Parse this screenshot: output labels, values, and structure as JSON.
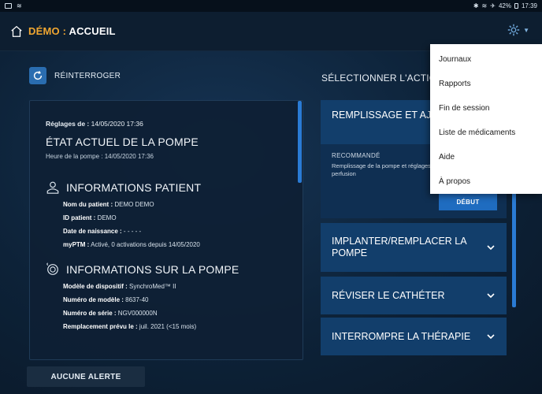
{
  "status_bar": {
    "battery": "42%",
    "time": "17:39"
  },
  "header": {
    "demo": "DÉMO",
    "separator": " : ",
    "title": "ACCUEIL"
  },
  "refresh": {
    "label": "RÉINTERROGER"
  },
  "left": {
    "settings_label": "Réglages de :",
    "settings_value": " 14/05/2020 17:36",
    "pump_state_title": "ÉTAT ACTUEL DE LA POMPE",
    "pump_time": "Heure de la pompe :  14/05/2020 17:36",
    "patient_section": "INFORMATIONS PATIENT",
    "patient": [
      {
        "label": "Nom du patient :",
        "value": " DEMO DEMO"
      },
      {
        "label": "ID patient :",
        "value": " DEMO"
      },
      {
        "label": "Date de naissance :",
        "value": " - - - - -"
      },
      {
        "label": "myPTM :",
        "value": " Activé, 0 activations depuis 14/05/2020"
      }
    ],
    "pump_section": "INFORMATIONS SUR LA POMPE",
    "pump": [
      {
        "label": "Modèle de dispositif :",
        "value": " SynchroMed™ II"
      },
      {
        "label": "Numéro de modèle :",
        "value": " 8637-40"
      },
      {
        "label": "Numéro de série :",
        "value": " NGV000000N"
      },
      {
        "label": "Remplacement prévu le :",
        "value": " juil. 2021 (<15 mois)"
      }
    ]
  },
  "alert": {
    "label": "AUCUNE ALERTE"
  },
  "right": {
    "heading": "SÉLECTIONNER L'ACTION",
    "card1": {
      "title": "REMPLISSAGE ET AJUSTEMENT",
      "recommended": "RECOMMANDÉ",
      "description": "Remplissage de la pompe et réglages de perfusion",
      "start": "DÉBUT"
    },
    "card2": {
      "title": "IMPLANTER/REMPLACER LA POMPE"
    },
    "card3": {
      "title": "RÉVISER LE CATHÉTER"
    },
    "card4": {
      "title": "INTERROMPRE LA THÉRAPIE"
    }
  },
  "menu": {
    "items": [
      "Journaux",
      "Rapports",
      "Fin de session",
      "Liste de médicaments",
      "Aide",
      "À propos"
    ]
  }
}
